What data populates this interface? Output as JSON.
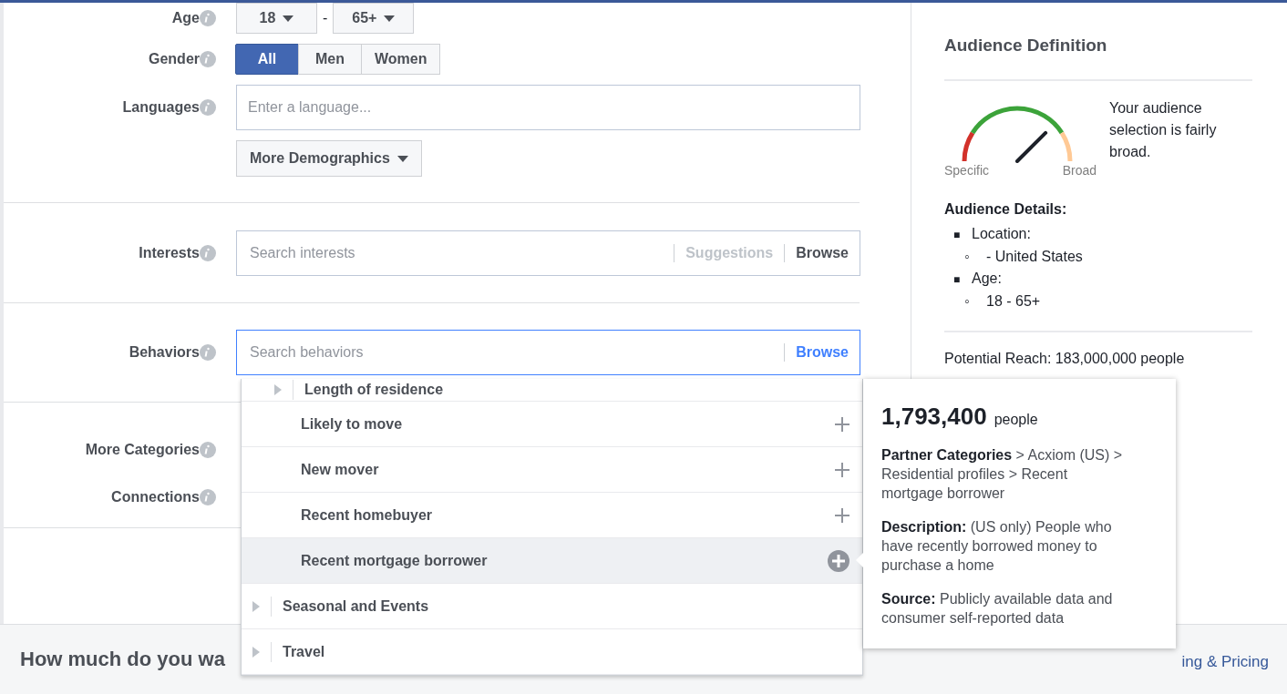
{
  "age": {
    "label": "Age",
    "from": "18",
    "separator": "-",
    "to": "65+"
  },
  "gender": {
    "label": "Gender",
    "options": [
      {
        "label": "All",
        "selected": true
      },
      {
        "label": "Men",
        "selected": false
      },
      {
        "label": "Women",
        "selected": false
      }
    ]
  },
  "languages": {
    "label": "Languages",
    "placeholder": "Enter a language..."
  },
  "more_demographics": "More Demographics",
  "interests": {
    "label": "Interests",
    "placeholder": "Search interests",
    "links": [
      {
        "label": "Suggestions",
        "disabled": true
      },
      {
        "label": "Browse",
        "disabled": false
      }
    ]
  },
  "behaviors": {
    "label": "Behaviors",
    "placeholder": "Search behaviors",
    "browse": "Browse",
    "focused": true
  },
  "more_categories": {
    "label": "More Categories"
  },
  "connections": {
    "label": "Connections"
  },
  "dropdown": {
    "items": [
      {
        "kind": "subcategory",
        "label": "Length of residence",
        "selected": false
      },
      {
        "kind": "item",
        "label": "Likely to move",
        "selected": false
      },
      {
        "kind": "item",
        "label": "New mover",
        "selected": false
      },
      {
        "kind": "item",
        "label": "Recent homebuyer",
        "selected": false
      },
      {
        "kind": "item",
        "label": "Recent mortgage borrower",
        "selected": true
      },
      {
        "kind": "category",
        "label": "Seasonal and Events",
        "selected": false
      },
      {
        "kind": "category",
        "label": "Travel",
        "selected": false
      }
    ]
  },
  "tooltip": {
    "count": "1,793,400",
    "unit": "people",
    "path": "**Partner Categories** > Acxiom (US) > Residential profiles > Recent mortgage borrower",
    "description": "**Description:** (US only) People who have recently borrowed money to purchase a home",
    "source": "**Source:** Publicly available data and consumer self-reported data"
  },
  "footer": {
    "heading": "How much do you wa",
    "link": "ing & Pricing"
  },
  "audience": {
    "title": "Audience Definition",
    "gauge": {
      "level": 0.75,
      "min_label": "Specific",
      "max_label": "Broad"
    },
    "summary": "Your audience selection is fairly broad.",
    "details_title": "Audience Details:",
    "details": [
      {
        "marker": "■",
        "label": "Location:",
        "children": [
          {
            "marker": "◦",
            "label": "- United States"
          }
        ]
      },
      {
        "marker": "■",
        "label": "Age:",
        "children": [
          {
            "marker": "◦",
            "label": "18 - 65+"
          }
        ]
      }
    ],
    "reach": "Potential Reach: 183,000,000 people"
  }
}
